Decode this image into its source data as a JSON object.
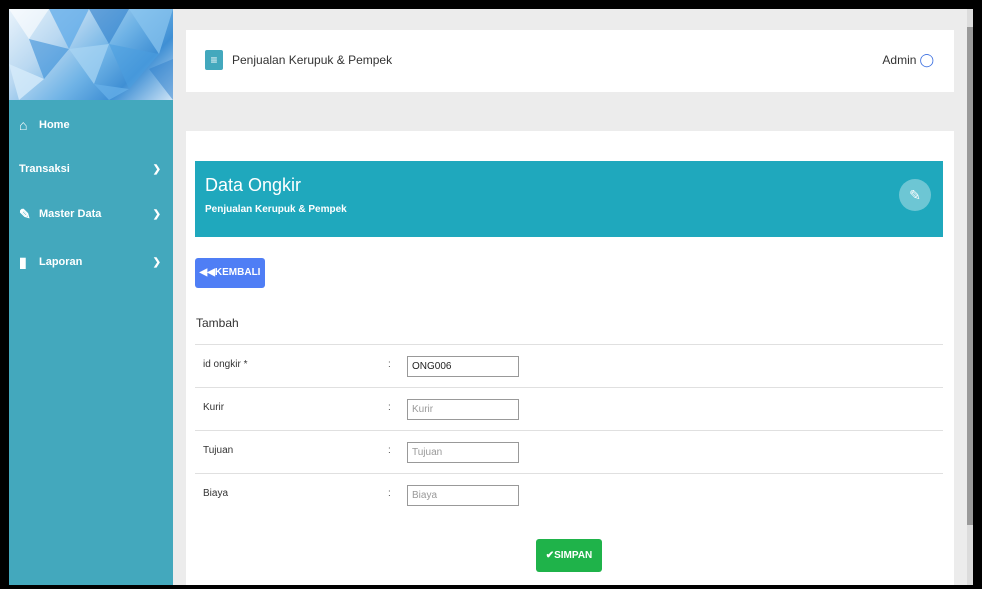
{
  "sidebar": {
    "items": [
      {
        "icon": "home-icon",
        "label": "Home",
        "chevron": false
      },
      {
        "icon": "",
        "label": "Transaksi",
        "chevron": true
      },
      {
        "icon": "edit-icon",
        "label": "Master Data",
        "chevron": true
      },
      {
        "icon": "file-icon",
        "label": "Laporan",
        "chevron": true
      }
    ]
  },
  "topbar": {
    "menu_icon": "hamburger-icon",
    "title": "Penjualan Kerupuk & Pempek",
    "user_label": "Admin",
    "user_icon": "user-icon"
  },
  "banner": {
    "title": "Data Ongkir",
    "subtitle": "Penjualan Kerupuk & Pempek",
    "action_icon": "edit-icon"
  },
  "back_button": {
    "icon": "double-left-arrow-icon",
    "label": "KEMBALI"
  },
  "form": {
    "section_title": "Tambah",
    "fields": [
      {
        "label": "id ongkir *",
        "value": "ONG006",
        "placeholder": ""
      },
      {
        "label": "Kurir",
        "value": "",
        "placeholder": "Kurir"
      },
      {
        "label": "Tujuan",
        "value": "",
        "placeholder": "Tujuan"
      },
      {
        "label": "Biaya",
        "value": "",
        "placeholder": "Biaya"
      }
    ],
    "colon": ":",
    "save_label": "SIMPAN",
    "save_icon": "check-icon"
  },
  "colors": {
    "sidebar": "#43a8bd",
    "banner": "#1fa8bd",
    "back_button": "#4f7ef5",
    "save_button": "#1fb34a"
  }
}
